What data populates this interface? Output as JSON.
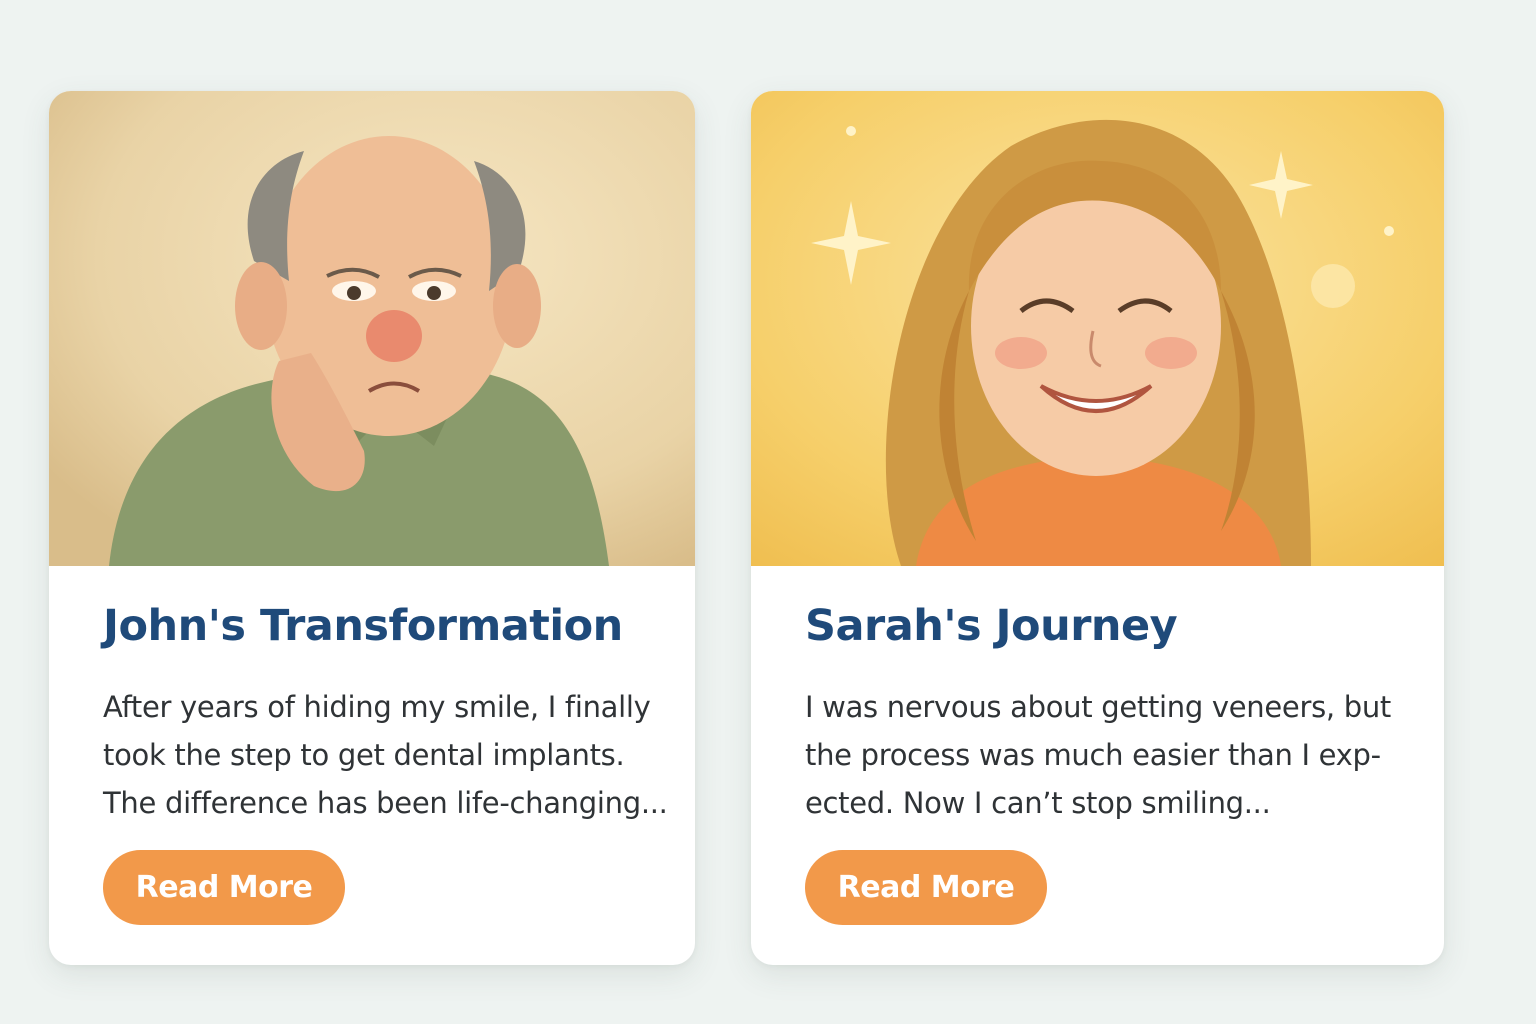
{
  "cards": [
    {
      "title": "John's Transformation",
      "body_lines": [
        "After years of hiding my smile, I finally",
        "took the step to get dental implants.",
        "The difference has been life-changing..."
      ],
      "button_label": "Read More"
    },
    {
      "title": "Sarah's Journey",
      "body_lines": [
        "I was nervous about getting veneers, but",
        "the process was much easier than I exp-",
        "ected. Now I can’t stop smiling..."
      ],
      "button_label": "Read More"
    }
  ],
  "colors": {
    "page_background": "#eef3f1",
    "title": "#1f4a7a",
    "body_text": "#2f3336",
    "button": "#f2994a",
    "button_text": "#ffffff"
  }
}
